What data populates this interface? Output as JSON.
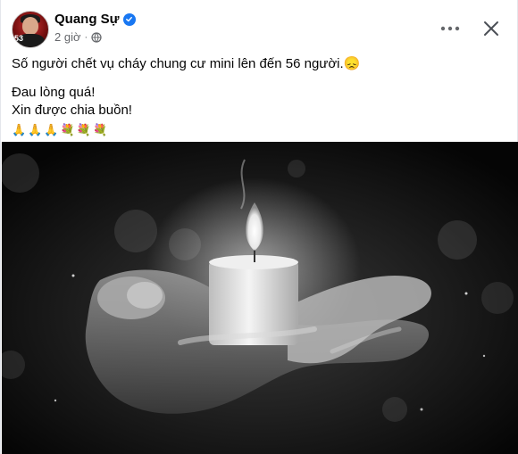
{
  "post": {
    "author_name": "Quang Sự",
    "timestamp": "2 giờ",
    "separator": "·",
    "avatar_number": "53",
    "text_line1": "Số người chết vụ cháy chung cư mini lên đến 56 người.",
    "text_line2": "Đau lòng quá!",
    "text_line3": "Xin được chia buồn!",
    "sad_emoji": "😞",
    "emoji_row": [
      "🙏",
      "🙏",
      "🙏",
      "💐",
      "💐",
      "💐"
    ]
  },
  "icons": {
    "verified": "verified-badge-icon",
    "audience": "globe-icon",
    "more": "more-options-icon",
    "close": "close-icon"
  },
  "colors": {
    "brand_blue": "#1877f2",
    "text_primary": "#050505",
    "text_secondary": "#65676b"
  }
}
